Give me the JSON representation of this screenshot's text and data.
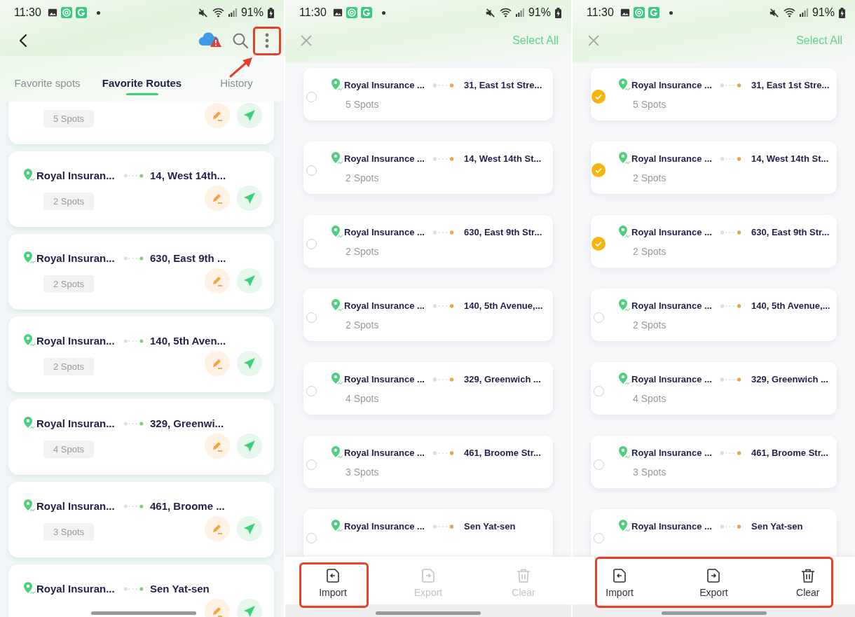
{
  "screens": [
    {
      "kind": "routes",
      "status_bar": {
        "time": "11:30",
        "battery": "91%"
      },
      "header": {
        "more_highlighted": true
      },
      "tabs": [
        {
          "label": "Favorite spots",
          "selected": false
        },
        {
          "label": "Favorite Routes",
          "selected": true
        },
        {
          "label": "History",
          "selected": false
        }
      ],
      "routes": [
        {
          "spots": "5 Spots"
        },
        {
          "origin": "Royal Insuran...",
          "destination": "14, West 14th...",
          "spots": "2 Spots"
        },
        {
          "origin": "Royal Insuran...",
          "destination": "630, East 9th ...",
          "spots": "2 Spots"
        },
        {
          "origin": "Royal Insuran...",
          "destination": "140, 5th Aven...",
          "spots": "2 Spots"
        },
        {
          "origin": "Royal Insuran...",
          "destination": "329, Greenwi...",
          "spots": "4 Spots"
        },
        {
          "origin": "Royal Insuran...",
          "destination": "461, Broome ...",
          "spots": "3 Spots"
        },
        {
          "origin": "Royal Insuran...",
          "destination": "Sen Yat-sen"
        }
      ]
    },
    {
      "kind": "select",
      "status_bar": {
        "time": "11:30",
        "battery": "91%"
      },
      "select_all": "Select All",
      "routes": [
        {
          "origin": "Royal Insurance ...",
          "destination": "31, East 1st Stre...",
          "spots": "5 Spots",
          "selected": false
        },
        {
          "origin": "Royal Insurance ...",
          "destination": "14, West 14th St...",
          "spots": "2 Spots",
          "selected": false
        },
        {
          "origin": "Royal Insurance ...",
          "destination": "630, East 9th Str...",
          "spots": "2 Spots",
          "selected": false
        },
        {
          "origin": "Royal Insurance ...",
          "destination": "140, 5th Avenue,...",
          "spots": "2 Spots",
          "selected": false
        },
        {
          "origin": "Royal Insurance ...",
          "destination": "329, Greenwich ...",
          "spots": "4 Spots",
          "selected": false
        },
        {
          "origin": "Royal Insurance ...",
          "destination": "461, Broome Str...",
          "spots": "3 Spots",
          "selected": false
        },
        {
          "origin": "Royal Insurance ...",
          "destination": "Sen Yat-sen",
          "selected": false
        }
      ],
      "actions": [
        {
          "kind": "import",
          "label": "Import",
          "disabled": false,
          "highlighted": true
        },
        {
          "kind": "export",
          "label": "Export",
          "disabled": true,
          "highlighted": false
        },
        {
          "kind": "clear",
          "label": "Clear",
          "disabled": true,
          "highlighted": false
        }
      ]
    },
    {
      "kind": "select",
      "status_bar": {
        "time": "11:30",
        "battery": "91%"
      },
      "select_all": "Select All",
      "action_bar_highlighted": true,
      "routes": [
        {
          "origin": "Royal Insurance ...",
          "destination": "31, East 1st Stre...",
          "spots": "5 Spots",
          "selected": true
        },
        {
          "origin": "Royal Insurance ...",
          "destination": "14, West 14th St...",
          "spots": "2 Spots",
          "selected": true
        },
        {
          "origin": "Royal Insurance ...",
          "destination": "630, East 9th Str...",
          "spots": "2 Spots",
          "selected": true
        },
        {
          "origin": "Royal Insurance ...",
          "destination": "140, 5th Avenue,...",
          "spots": "2 Spots",
          "selected": false
        },
        {
          "origin": "Royal Insurance ...",
          "destination": "329, Greenwich ...",
          "spots": "4 Spots",
          "selected": false
        },
        {
          "origin": "Royal Insurance ...",
          "destination": "461, Broome Str...",
          "spots": "3 Spots",
          "selected": false
        },
        {
          "origin": "Royal Insurance ...",
          "destination": "Sen Yat-sen",
          "selected": false
        }
      ],
      "actions": [
        {
          "kind": "import",
          "label": "Import",
          "disabled": false,
          "highlighted": false
        },
        {
          "kind": "export",
          "label": "Export",
          "disabled": false,
          "highlighted": false
        },
        {
          "kind": "clear",
          "label": "Clear",
          "disabled": false,
          "highlighted": false
        }
      ]
    }
  ]
}
